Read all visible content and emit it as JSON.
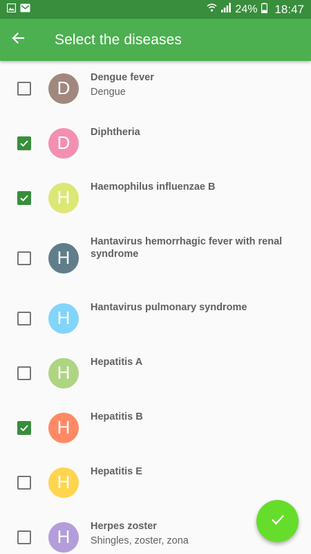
{
  "status_bar": {
    "battery_percent": "24%",
    "time": "18:47",
    "icons": [
      "image-notification-icon",
      "mail-notification-icon",
      "wifi-icon",
      "signal-icon",
      "battery-icon"
    ]
  },
  "app_bar": {
    "title": "Select the diseases",
    "back_icon": "arrow-back-icon"
  },
  "colors": {
    "status_bar": "#388e3c",
    "app_bar": "#4caf50",
    "checkbox_checked": "#388e3c",
    "fab": "#66dd2a"
  },
  "diseases": [
    {
      "letter": "D",
      "name": "Dengue fever",
      "subtitle": "Dengue",
      "checked": false,
      "color": "#a1887f"
    },
    {
      "letter": "D",
      "name": "Diphtheria",
      "subtitle": "",
      "checked": true,
      "color": "#f48fb1"
    },
    {
      "letter": "H",
      "name": "Haemophilus influenzae B",
      "subtitle": "",
      "checked": true,
      "color": "#dce775"
    },
    {
      "letter": "H",
      "name": "Hantavirus hemorrhagic fever with renal syndrome",
      "subtitle": "",
      "checked": false,
      "color": "#607d8b"
    },
    {
      "letter": "H",
      "name": "Hantavirus pulmonary syndrome",
      "subtitle": "",
      "checked": false,
      "color": "#81d4fa"
    },
    {
      "letter": "H",
      "name": "Hepatitis A",
      "subtitle": "",
      "checked": false,
      "color": "#aed581"
    },
    {
      "letter": "H",
      "name": "Hepatitis B",
      "subtitle": "",
      "checked": true,
      "color": "#ff8a65"
    },
    {
      "letter": "H",
      "name": "Hepatitis E",
      "subtitle": "",
      "checked": false,
      "color": "#ffd54f"
    },
    {
      "letter": "H",
      "name": "Herpes zoster",
      "subtitle": "Shingles, zoster, zona",
      "checked": false,
      "color": "#b39ddb"
    }
  ],
  "fab": {
    "icon": "check-icon"
  }
}
